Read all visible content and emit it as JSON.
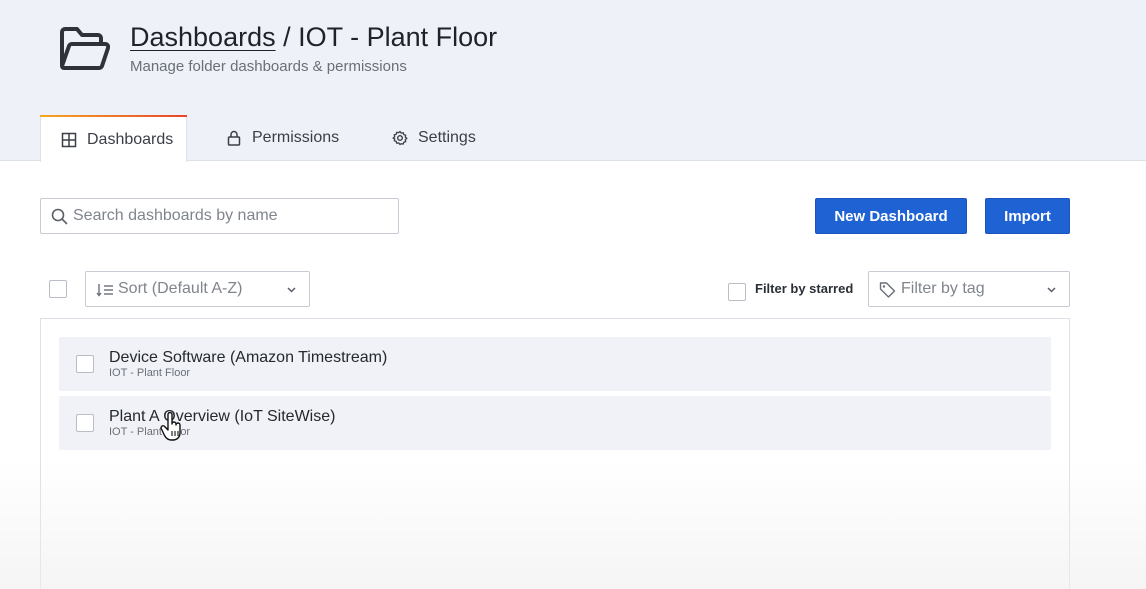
{
  "header": {
    "breadcrumb_link": "Dashboards",
    "breadcrumb_sep": " / ",
    "folder_name": "IOT - Plant Floor",
    "subtitle": "Manage folder dashboards & permissions"
  },
  "tabs": [
    {
      "label": "Dashboards",
      "icon": "apps-grid-icon",
      "active": true
    },
    {
      "label": "Permissions",
      "icon": "lock-icon",
      "active": false
    },
    {
      "label": "Settings",
      "icon": "cog-icon",
      "active": false
    }
  ],
  "search": {
    "placeholder": "Search dashboards by name",
    "value": ""
  },
  "actions": {
    "new_dashboard": "New Dashboard",
    "import": "Import"
  },
  "filters": {
    "sort_placeholder": "Sort (Default A-Z)",
    "starred_label": "Filter by starred",
    "tag_placeholder": "Filter by tag"
  },
  "dashboards": [
    {
      "title": "Device Software (Amazon Timestream)",
      "folder": "IOT - Plant Floor"
    },
    {
      "title": "Plant A Overview (IoT SiteWise)",
      "folder": "IOT - Plant Floor"
    }
  ],
  "colors": {
    "primary": "#1f62d4",
    "header_bg": "#eef1f7",
    "row_bg": "#f0f2f7"
  }
}
